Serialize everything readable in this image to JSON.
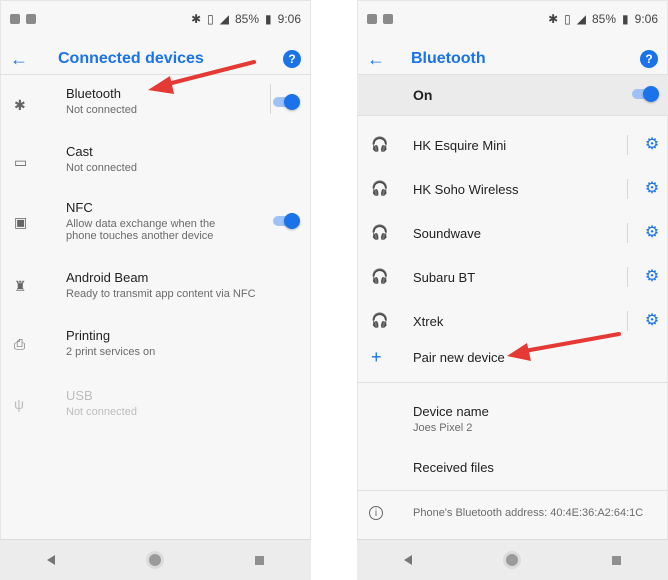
{
  "left": {
    "status": {
      "battery": "85%",
      "time": "9:06"
    },
    "toolbar": {
      "title": "Connected devices",
      "help": "?"
    },
    "items": [
      {
        "title": "Bluetooth",
        "subtitle": "Not connected",
        "icon": "bluetooth-icon",
        "toggle": true
      },
      {
        "title": "Cast",
        "subtitle": "Not connected",
        "icon": "cast-icon",
        "toggle": false
      },
      {
        "title": "NFC",
        "subtitle": "Allow data exchange when the phone touches another device",
        "icon": "nfc-icon",
        "toggle": true
      },
      {
        "title": "Android Beam",
        "subtitle": "Ready to transmit app content via NFC",
        "icon": "android-icon",
        "toggle": false
      },
      {
        "title": "Printing",
        "subtitle": "2 print services on",
        "icon": "printer-icon",
        "toggle": false
      },
      {
        "title": "USB",
        "subtitle": "Not connected",
        "icon": "usb-icon",
        "disabled": true
      }
    ]
  },
  "right": {
    "status": {
      "battery": "85%",
      "time": "9:06"
    },
    "toolbar": {
      "title": "Bluetooth",
      "help": "?"
    },
    "on_label": "On",
    "devices": [
      {
        "name": "HK Esquire Mini"
      },
      {
        "name": "HK Soho Wireless"
      },
      {
        "name": "Soundwave"
      },
      {
        "name": "Subaru BT"
      },
      {
        "name": "Xtrek"
      }
    ],
    "pair_new": "Pair new device",
    "device_name": {
      "title": "Device name",
      "value": "Joes Pixel 2"
    },
    "received_files": "Received files",
    "address": "Phone's Bluetooth address: 40:4E:36:A2:64:1C"
  },
  "colors": {
    "accent": "#1a73e8",
    "annotation": "#e53935"
  }
}
